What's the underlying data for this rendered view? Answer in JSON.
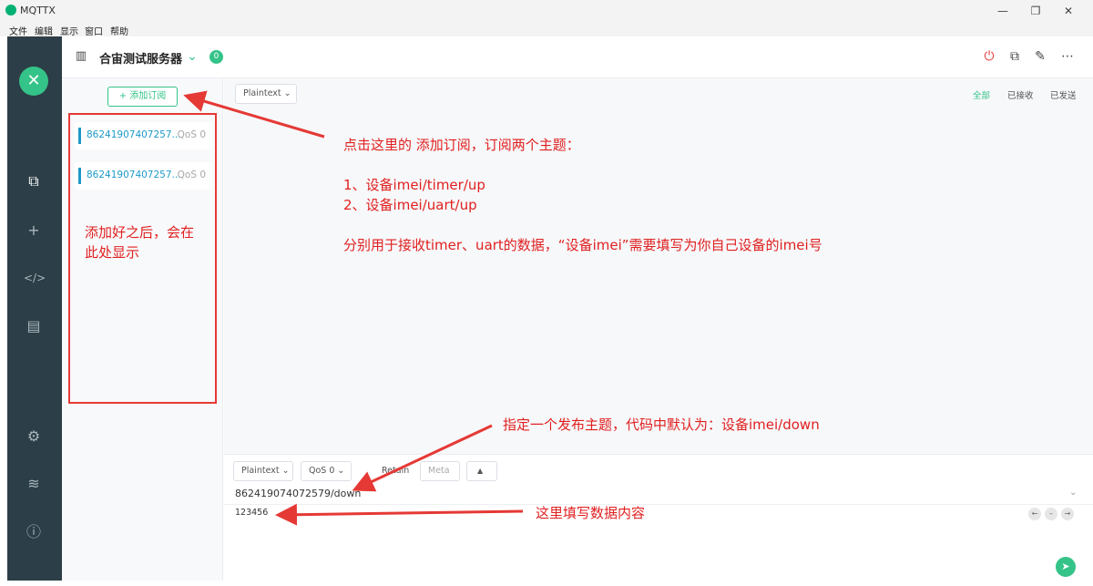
{
  "window": {
    "title": "MQTTX",
    "menu": [
      "文件",
      "编辑",
      "显示",
      "窗口",
      "帮助"
    ]
  },
  "header": {
    "connection_name": "合宙测试服务器",
    "badge_count": "0"
  },
  "subscriptions": {
    "add_label": "添加订阅",
    "items": [
      {
        "topic": "86241907407257...",
        "qos": "QoS 0"
      },
      {
        "topic": "86241907407257...",
        "qos": "QoS 0"
      }
    ]
  },
  "messages": {
    "format": "Plaintext",
    "filters": [
      "全部",
      "已接收",
      "已发送"
    ]
  },
  "publish": {
    "format": "Plaintext",
    "qos": "QoS 0",
    "retain_label": "Retain",
    "meta_label": "Meta",
    "topic": "862419074072579/down",
    "payload": "123456"
  },
  "annotations": {
    "subscribe_note": "点击这里的 添加订阅，订阅两个主题：\n\n1、设备imei/timer/up\n2、设备imei/uart/up\n\n分别用于接收timer、uart的数据，“设备imei”需要填写为你自己设备的imei号",
    "list_note": "添加好之后，会在\n此处显示",
    "publish_note": "指定一个发布主题，代码中默认为：设备imei/down",
    "payload_note": "这里填写数据内容"
  },
  "colors": {
    "accent": "#34c388",
    "sidebar": "#2c3e47",
    "annotation": "#e02020",
    "topic": "#1d99c8"
  }
}
